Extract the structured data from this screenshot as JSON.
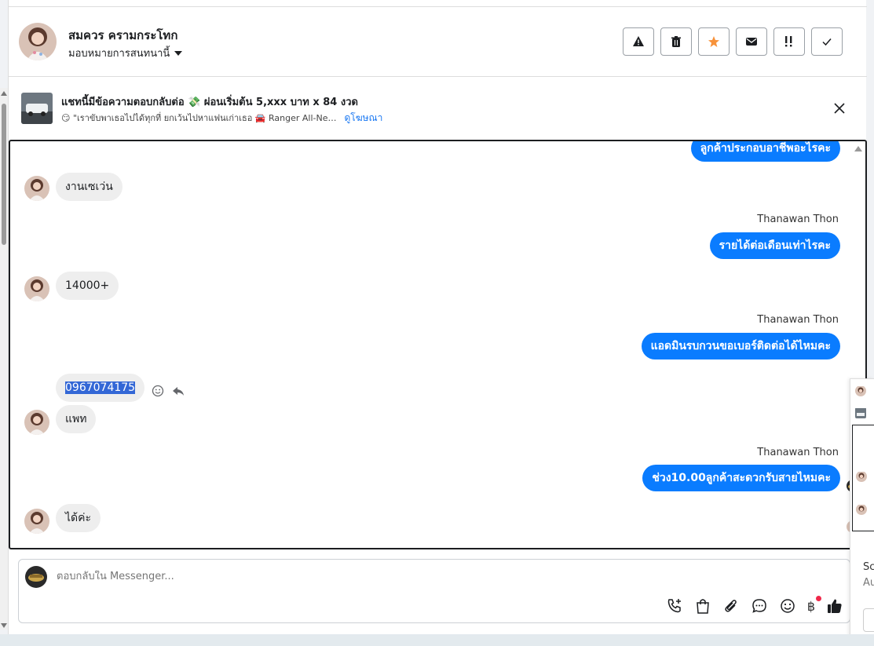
{
  "header": {
    "contact_name": "สมควร ครามกระโทก",
    "assign_label": "มอบหมายการสนทนานี้",
    "toolbar": [
      {
        "name": "spam-warning-icon"
      },
      {
        "name": "trash-icon"
      },
      {
        "name": "star-icon"
      },
      {
        "name": "mail-icon"
      },
      {
        "name": "follow-up-icon"
      },
      {
        "name": "done-check-icon"
      }
    ]
  },
  "ad": {
    "title": "แชทนี้มีข้อความตอบกลับต่อ 💸 ผ่อนเริ่มต้น 5,xxx บาท x 84 งวด",
    "subtitle": "😏 \"เราขับพาเธอไปได้ทุกที่ ยกเว้นไปหาแฟนเก่าเธอ 🚘 Ranger All-Ne…",
    "link": "ดูโฆษณา"
  },
  "messages": {
    "out_top": "ลูกค้าประกอบอาชีพอะไรคะ",
    "in_1": "งานเซเว่น",
    "sender_1": "Thanawan Thon",
    "out_1": "รายได้ต่อเดือนเท่าไรคะ",
    "in_2": "14000+",
    "sender_2": "Thanawan Thon",
    "out_2": "แอดมินรบกวนขอเบอร์ติดต่อได้ไหมคะ",
    "in_3": "0967074175",
    "in_4": "แพท",
    "sender_3": "Thanawan Thon",
    "out_3": "ช่วง10.00ลูกค้าสะดวกรับสายไหมคะ",
    "in_5": "ได้ค่ะ"
  },
  "composer": {
    "placeholder": "ตอบกลับใน Messenger...",
    "baht_symbol": "฿"
  },
  "right_panel": {
    "text_1": "Sc",
    "text_2": "Au"
  },
  "colors": {
    "outgoing_bubble": "#0a7cff",
    "incoming_bubble": "#eeeeee",
    "accent_link": "#1877f2",
    "star": "#f7923a",
    "notification_dot": "#f0284a"
  }
}
